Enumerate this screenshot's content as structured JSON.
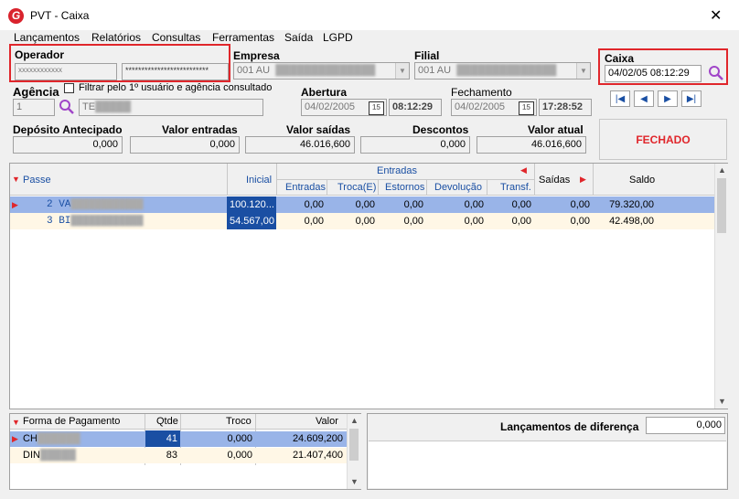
{
  "window": {
    "title": "PVT - Caixa",
    "logo": "G"
  },
  "menu": [
    "Lançamentos",
    "Relatórios",
    "Consultas",
    "Ferramentas",
    "Saída",
    "LGPD"
  ],
  "operador": {
    "label": "Operador",
    "code": "xxxxxxxxxxxx",
    "password": "**************************"
  },
  "empresa": {
    "label": "Empresa",
    "value": "001 AU"
  },
  "filial": {
    "label": "Filial",
    "value": "001 AU"
  },
  "caixa": {
    "label": "Caixa",
    "value": "04/02/05 08:12:29"
  },
  "agencia": {
    "label": "Agência",
    "code": "1",
    "name": "TE",
    "filter_label": "Filtrar pelo 1º usuário e agência consultado"
  },
  "abertura": {
    "label": "Abertura",
    "date": "04/02/2005",
    "time": "08:12:29"
  },
  "fechamento": {
    "label": "Fechamento",
    "date": "04/02/2005",
    "time": "17:28:52"
  },
  "totals": {
    "deposito_label": "Depósito Antecipado",
    "deposito": "0,000",
    "entradas_label": "Valor entradas",
    "entradas": "0,000",
    "saidas_label": "Valor saídas",
    "saidas": "46.016,600",
    "descontos_label": "Descontos",
    "descontos": "0,000",
    "atual_label": "Valor atual",
    "atual": "46.016,600"
  },
  "status": "FECHADO",
  "grid": {
    "headers": {
      "passe": "Passe",
      "inicial": "Inicial",
      "entradas_group": "Entradas",
      "entradas": "Entradas",
      "troca": "Troca(E)",
      "estornos": "Estornos",
      "devolucao": "Devolução",
      "transf": "Transf.",
      "saidas": "Saídas",
      "saldo": "Saldo"
    },
    "rows": [
      {
        "passe": "2 VA",
        "inicial": "100.120...",
        "entradas": "0,00",
        "troca": "0,00",
        "estornos": "0,00",
        "devolucao": "0,00",
        "transf": "0,00",
        "saidas": "0,00",
        "saldo": "79.320,00"
      },
      {
        "passe": "3 BI",
        "inicial": "54.567,00",
        "entradas": "0,00",
        "troca": "0,00",
        "estornos": "0,00",
        "devolucao": "0,00",
        "transf": "0,00",
        "saidas": "0,00",
        "saldo": "42.498,00"
      }
    ]
  },
  "payments": {
    "headers": {
      "forma": "Forma de Pagamento",
      "qtde": "Qtde",
      "troco": "Troco",
      "valor": "Valor"
    },
    "rows": [
      {
        "forma": "CH",
        "qtde": "41",
        "troco": "0,000",
        "valor": "24.609,200"
      },
      {
        "forma": "DIN",
        "qtde": "83",
        "troco": "0,000",
        "valor": "21.407,400"
      }
    ]
  },
  "diferenca": {
    "label": "Lançamentos de diferença",
    "value": "0,000"
  },
  "colors": {
    "accent": "#1a4fa3",
    "selection": "#99b4e8",
    "danger": "#e0262b"
  },
  "icons": [
    "search-icon",
    "calendar-icon",
    "first-icon",
    "prev-icon",
    "next-icon",
    "last-icon",
    "close-icon"
  ]
}
